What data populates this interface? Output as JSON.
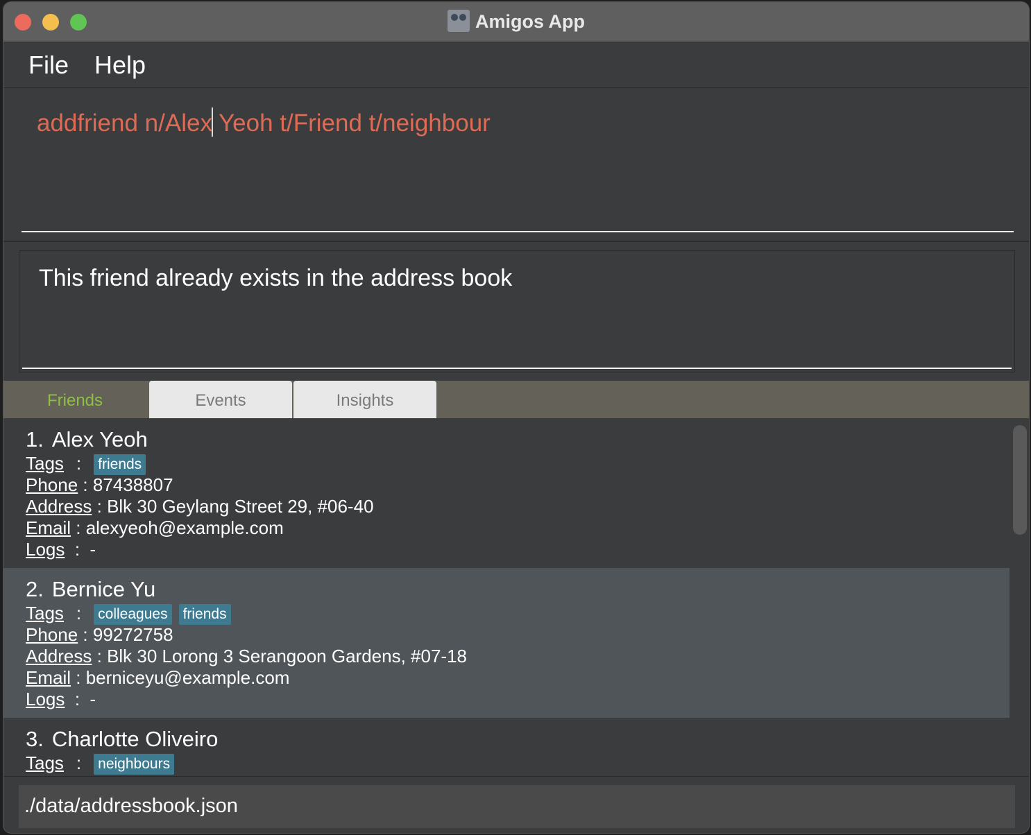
{
  "window": {
    "title": "Amigos App"
  },
  "menu": {
    "file": "File",
    "help": "Help"
  },
  "command": {
    "before_caret": "addfriend n/Alex",
    "after_caret": " Yeoh t/Friend t/neighbour"
  },
  "result": {
    "message": "This friend already exists in the address book"
  },
  "tabs": [
    {
      "label": "Friends",
      "active": true
    },
    {
      "label": "Events",
      "active": false
    },
    {
      "label": "Insights",
      "active": false
    }
  ],
  "labels": {
    "tags": "Tags",
    "phone": "Phone",
    "address": "Address",
    "email": "Email",
    "logs": "Logs"
  },
  "friends": [
    {
      "index": "1.",
      "name": "Alex Yeoh",
      "tags": [
        "friends"
      ],
      "phone": "87438807",
      "address": "Blk 30 Geylang Street 29, #06-40",
      "email": "alexyeoh@example.com",
      "logs": "-"
    },
    {
      "index": "2.",
      "name": "Bernice Yu",
      "tags": [
        "colleagues",
        "friends"
      ],
      "phone": "99272758",
      "address": "Blk 30 Lorong 3 Serangoon Gardens, #07-18",
      "email": "berniceyu@example.com",
      "logs": "-"
    },
    {
      "index": "3.",
      "name": "Charlotte Oliveiro",
      "tags": [
        "neighbours"
      ]
    }
  ],
  "status": {
    "path": "./data/addressbook.json"
  },
  "colors": {
    "command_text": "#dd6b55",
    "active_tab": "#8fbf45",
    "tag_bg": "#3e7b91"
  }
}
